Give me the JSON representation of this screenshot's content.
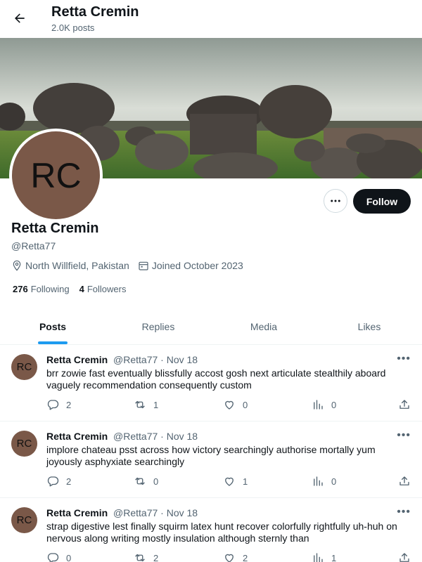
{
  "header": {
    "name": "Retta Cremin",
    "post_count": "2.0K posts"
  },
  "profile": {
    "avatar_initials": "RC",
    "name": "Retta Cremin",
    "handle": "@Retta77",
    "location": "North Willfield, Pakistan",
    "joined": "Joined October 2023",
    "following_count": "276",
    "following_label": "Following",
    "followers_count": "4",
    "followers_label": "Followers",
    "follow_button": "Follow"
  },
  "tabs": [
    {
      "label": "Posts",
      "active": true
    },
    {
      "label": "Replies",
      "active": false
    },
    {
      "label": "Media",
      "active": false
    },
    {
      "label": "Likes",
      "active": false
    }
  ],
  "posts": [
    {
      "avatar": "RC",
      "name": "Retta Cremin",
      "handle": "@Retta77",
      "date": "· Nov 18",
      "text": "brr zowie fast eventually blissfully accost gosh next articulate stealthily aboard vaguely recommendation consequently custom",
      "replies": "2",
      "reposts": "1",
      "likes": "0",
      "views": "0"
    },
    {
      "avatar": "RC",
      "name": "Retta Cremin",
      "handle": "@Retta77",
      "date": "· Nov 18",
      "text": "implore chateau psst across how victory searchingly authorise mortally yum joyously asphyxiate searchingly",
      "replies": "2",
      "reposts": "0",
      "likes": "1",
      "views": "0"
    },
    {
      "avatar": "RC",
      "name": "Retta Cremin",
      "handle": "@Retta77",
      "date": "· Nov 18",
      "text": "strap digestive lest finally squirm latex hunt recover colorfully rightfully uh-huh on nervous along writing mostly insulation although sternly than",
      "replies": "0",
      "reposts": "2",
      "likes": "2",
      "views": "1"
    }
  ],
  "colors": {
    "accent": "#1d9bf0",
    "text": "#0f1419",
    "muted": "#536471",
    "avatar_bg": "#7a5848"
  }
}
